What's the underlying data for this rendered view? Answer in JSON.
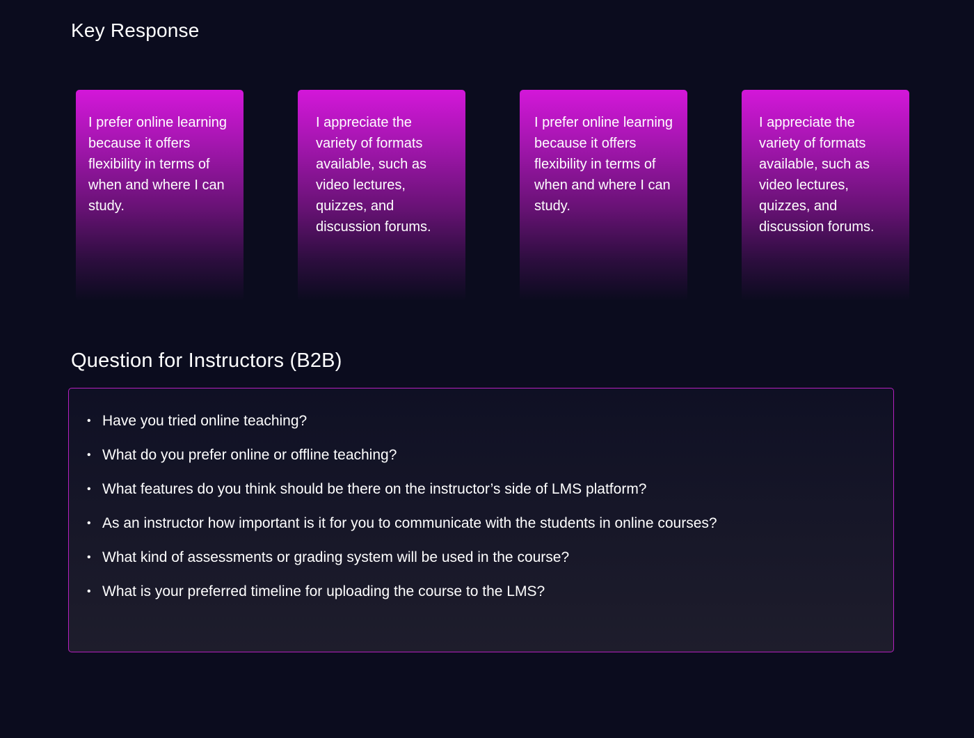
{
  "sections": {
    "key_response_title": "Key Response",
    "instructors_title": "Question for Instructors (B2B)"
  },
  "cards": [
    {
      "text": "I prefer online learning because it offers flexibility in terms of when and where I can study."
    },
    {
      "text": "I appreciate the variety of formats available, such as video lectures, quizzes, and discussion forums."
    },
    {
      "text": "I prefer online learning because it offers flexibility in terms of when and where I can study."
    },
    {
      "text": "I appreciate the variety of formats available, such as video lectures, quizzes, and discussion forums."
    }
  ],
  "questions": [
    "Have you tried online teaching?",
    "What do you prefer online or offline teaching?",
    "What features do you think should be there on the instructor’s side of LMS platform?",
    "As an instructor how important is it for you to communicate with the students in online courses?",
    "What kind of assessments or grading system will be used in the course?",
    "What is your preferred timeline for uploading the course to the LMS?"
  ],
  "bullet_glyph": "•",
  "colors": {
    "background": "#0b0c1e",
    "card_gradient_top": "#d317d9",
    "box_border": "#b620c0"
  }
}
